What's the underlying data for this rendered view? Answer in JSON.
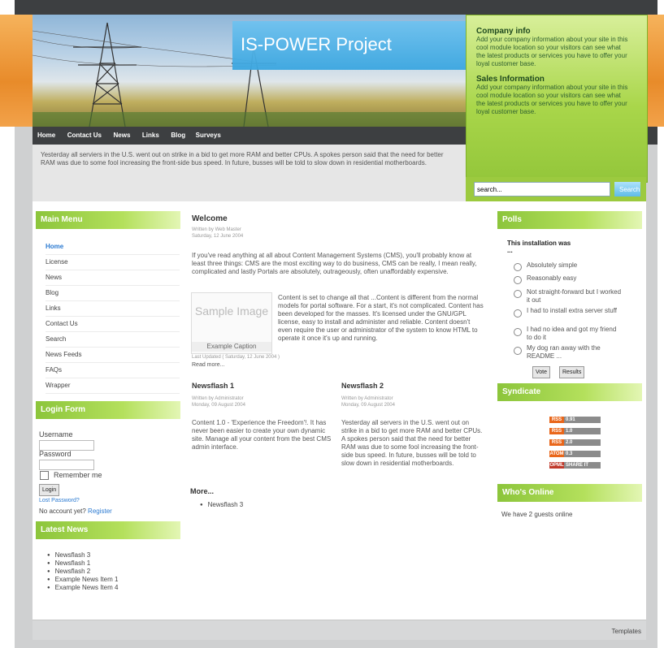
{
  "header": {
    "site_title": "IS-POWER Project",
    "nav": [
      "Home",
      "Contact Us",
      "News",
      "Links",
      "Blog",
      "Surveys"
    ]
  },
  "company_panel": {
    "company_title": "Company info",
    "company_text": "Add your company information about your site in this cool module location so your visitors can see what the latest products or services you have to offer your loyal customer base.",
    "sales_title": "Sales Information",
    "sales_text": "Add your company information about your site in this cool module location so your visitors can see what the latest products or services you have to offer your loyal customer base."
  },
  "search": {
    "value": "search...",
    "button": "Search"
  },
  "intro": "Yesterday all serviers in the U.S. went out on strike in a bid to get more RAM and better CPUs. A spokes person said that the need for better RAM was due to some fool increasing the front-side bus speed. In future, busses will be told to slow down in residential motherboards.",
  "main_menu": {
    "title": "Main Menu",
    "items": [
      "Home",
      "License",
      "News",
      "Blog",
      "Links",
      "Contact Us",
      "Search",
      "News Feeds",
      "FAQs",
      "Wrapper"
    ]
  },
  "login": {
    "title": "Login Form",
    "username_label": "Username",
    "password_label": "Password",
    "remember": "Remember me",
    "button": "Login",
    "lost": "Lost Password?",
    "no_account": "No account yet?",
    "register": "Register"
  },
  "latest_news": {
    "title": "Latest News",
    "items": [
      "Newsflash 3",
      "Newsflash 1",
      "Newsflash 2",
      "Example News Item 1",
      "Example News Item 4"
    ]
  },
  "welcome": {
    "title": "Welcome",
    "author": "Written by Web Master",
    "date": "Saturday, 12 June 2004",
    "p1": "If you've read anything at all about Content Management Systems (CMS), you'll probably know at least three things: CMS are the most exciting way to do business, CMS can be really, I mean really, complicated and lastly Portals are absolutely, outrageously, often unaffordably expensive.",
    "p2": "Content is set to change all that ...Content is different from the normal models for portal software. For a start, it's not complicated. Content has been developed for the masses. It's licensed under the GNU/GPL license, easy to install and administer and reliable. Content doesn't even require the user or administrator of the system to know HTML to operate it once it's up and running.",
    "image_text": "Sample Image",
    "caption": "Example Caption",
    "updated": "Last Updated ( Saturday, 12 June 2004 )",
    "read_more": "Read more..."
  },
  "newsflash1": {
    "title": "Newsflash 1",
    "author": "Written by Administrator",
    "date": "Monday, 09 August 2004",
    "text": "Content 1.0 - 'Experience the Freedom'!. It has never been easier to create your own dynamic site. Manage all your content from the best CMS admin interface."
  },
  "newsflash2": {
    "title": "Newsflash 2",
    "author": "Written by Administrator",
    "date": "Monday, 09 August 2004",
    "text": "Yesterday all servers in the U.S. went out on strike in a bid to get more RAM and better CPUs. A spokes person said that the need for better RAM was due to some fool increasing the front-side bus speed. In future, busses will be told to slow down in residential motherboards."
  },
  "more": {
    "title": "More...",
    "items": [
      "Newsflash 3"
    ]
  },
  "polls": {
    "title": "Polls",
    "question": "This installation was ...",
    "options": [
      "Absolutely simple",
      "Reasonably easy",
      "Not straight-forward but I worked it out",
      "I had to install extra server stuff",
      "I had no idea and got my friend to do it",
      "My dog ran away with the README ..."
    ],
    "vote": "Vote",
    "results": "Results"
  },
  "syndicate": {
    "title": "Syndicate",
    "feeds": [
      [
        "RSS",
        "0.91"
      ],
      [
        "RSS",
        "1.0"
      ],
      [
        "RSS",
        "2.0"
      ],
      [
        "ATOM",
        "0.3"
      ],
      [
        "OPML",
        "SHARE IT"
      ]
    ]
  },
  "who_online": {
    "title": "Who's Online",
    "text": "We have 2 guests online"
  },
  "footer": {
    "text": "Templates"
  },
  "colors": {
    "accent_green": "#8cc53b",
    "accent_blue": "#3aa6e0",
    "link": "#2b7ad1",
    "nav_dark": "#3d3f41"
  }
}
